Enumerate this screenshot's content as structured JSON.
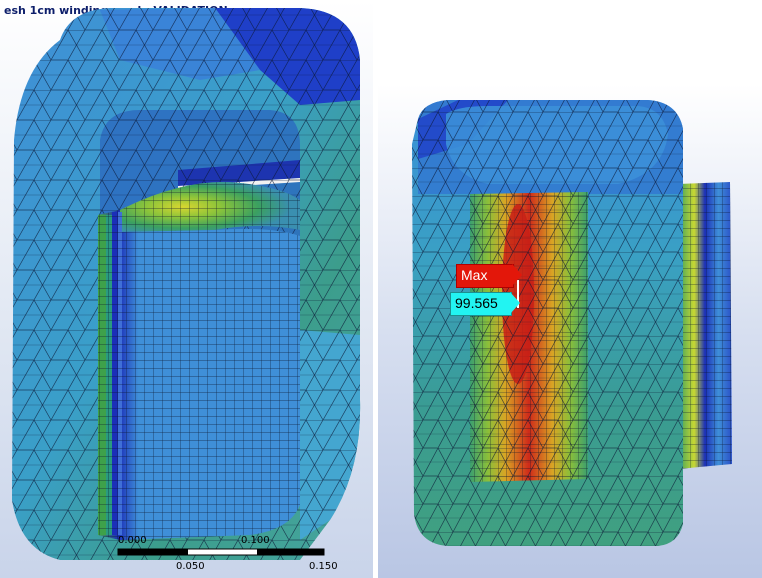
{
  "left_view": {
    "title": "esh 1cm winding mesh. VALIDATION",
    "scale_ruler": {
      "top_labels": [
        "0.000",
        "0.100"
      ],
      "bottom_labels": [
        "0.050",
        "0.150"
      ]
    }
  },
  "right_view": {
    "probe": {
      "label": "Max",
      "value": "99.565"
    }
  },
  "colors": {
    "mesh_deep_blue": "#1f3fc8",
    "mesh_light_blue": "#3f8fd8",
    "mesh_cyan": "#3aa7c0",
    "mesh_teal": "#3c9d8c",
    "mesh_green": "#4caf50",
    "mesh_yellow": "#c8d832",
    "mesh_orange": "#e08a1e",
    "mesh_red": "#d0201a",
    "max_flag": "#e3170a",
    "value_flag": "#22f4f2"
  }
}
